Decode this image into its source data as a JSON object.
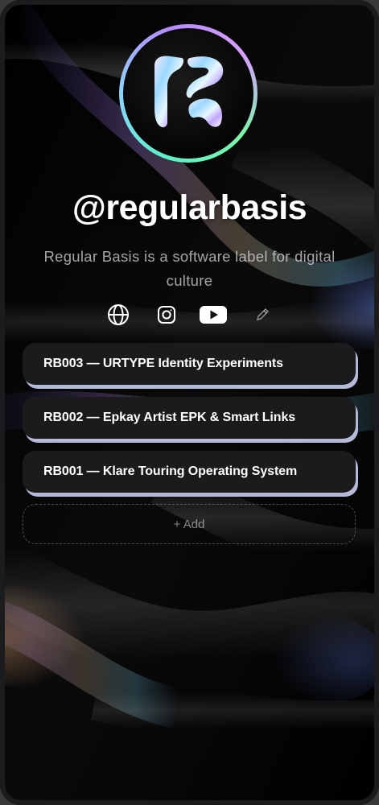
{
  "profile": {
    "handle": "@regularbasis",
    "bio": "Regular Basis is a software label for digital culture",
    "avatar_icon": "regular-basis-logo"
  },
  "socials": [
    {
      "icon": "globe-icon"
    },
    {
      "icon": "instagram-icon"
    },
    {
      "icon": "youtube-icon"
    },
    {
      "icon": "pencil-icon"
    }
  ],
  "links": [
    {
      "label": "RB003 — URTYPE Identity Experiments"
    },
    {
      "label": "RB002 — Epkay Artist EPK & Smart Links"
    },
    {
      "label": "RB001 — Klare Touring Operating System"
    }
  ],
  "add_label": "+ Add",
  "colors": {
    "card_bg": "#1b1a1c",
    "card_shadow": "#b4b9d8",
    "ring_start": "#5cf0c8",
    "ring_end": "#b58cff"
  }
}
